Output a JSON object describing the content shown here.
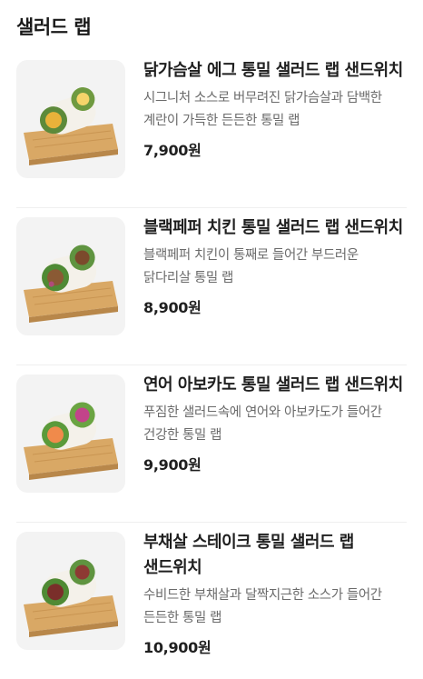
{
  "section": {
    "title": "샐러드 랩"
  },
  "items": [
    {
      "name": "닭가슴살 에그 통밀 샐러드 랩 샌드위치",
      "description": "시그니처 소스로 버무려진 닭가슴살과 담백한 계란이 가득한 든든한 통밀 랩",
      "price": "7,900원",
      "image_icon": "chicken-egg-wrap-image",
      "filling_color": "#e8b23a"
    },
    {
      "name": "블랙페퍼 치킨 통밀 샐러드 랩 샌드위치",
      "description": "블랙페퍼 치킨이 통째로 들어간 부드러운 닭다리살 통밀 랩",
      "price": "8,900원",
      "image_icon": "blackpepper-chicken-wrap-image",
      "filling_color": "#8a5a34"
    },
    {
      "name": "연어 아보카도 통밀 샐러드 랩 샌드위치",
      "description": "푸짐한 샐러드속에 연어와 아보카도가 들어간 건강한 통밀 랩",
      "price": "9,900원",
      "image_icon": "salmon-avocado-wrap-image",
      "filling_color": "#f08a4b"
    },
    {
      "name": "부채살 스테이크 통밀 샐러드 랩 샌드위치",
      "description": "수비드한 부채살과 달짝지근한 소스가 들어간 든든한 통밀 랩",
      "price": "10,900원",
      "image_icon": "steak-wrap-image",
      "filling_color": "#7a2e2a"
    }
  ]
}
